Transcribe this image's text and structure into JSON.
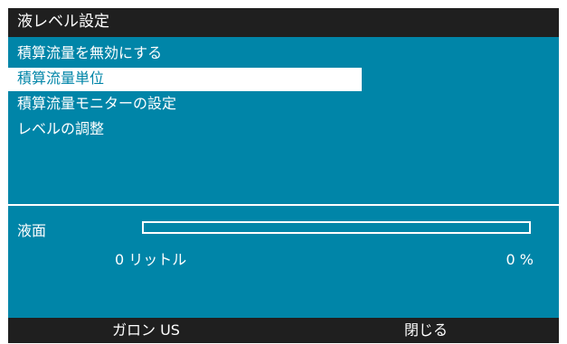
{
  "title": "液レベル設定",
  "menu": {
    "items": [
      {
        "label": "積算流量を無効にする",
        "selected": false
      },
      {
        "label": "積算流量単位",
        "selected": true
      },
      {
        "label": "積算流量モニターの設定",
        "selected": false
      },
      {
        "label": "レベルの調整",
        "selected": false
      }
    ]
  },
  "level": {
    "label": "液面",
    "volume_text": "0 リットル",
    "percent_text": "0 %",
    "fill_percent": 0
  },
  "softkeys": {
    "left_label": "ガロン US",
    "right_label": "閉じる"
  },
  "colors": {
    "background": "#0085a8",
    "bars": "#1f1f1f",
    "foreground": "#ffffff"
  }
}
